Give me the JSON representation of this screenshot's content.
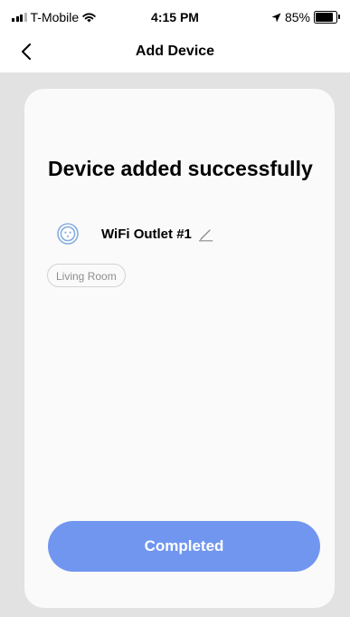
{
  "status_bar": {
    "carrier": "T-Mobile",
    "time": "4:15 PM",
    "battery": "85%"
  },
  "nav": {
    "title": "Add Device"
  },
  "card": {
    "title": "Device added successfully",
    "device_name": "WiFi Outlet #1",
    "room": "Living Room",
    "button_label": "Completed"
  },
  "colors": {
    "accent": "#7196f0",
    "background": "#e2e2e2",
    "card": "#fafafa"
  },
  "icons": [
    "signal-icon",
    "wifi-icon",
    "location-arrow-icon",
    "battery-icon",
    "back-chevron-icon",
    "outlet-icon",
    "pencil-icon"
  ]
}
